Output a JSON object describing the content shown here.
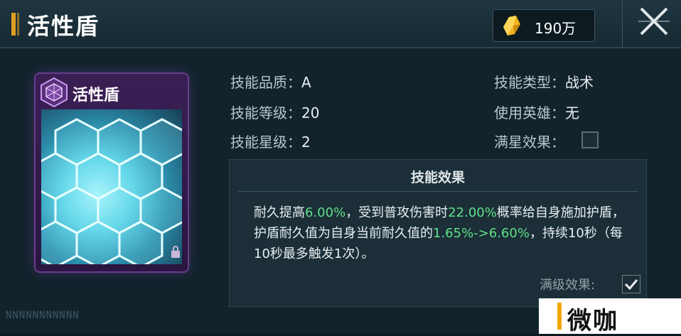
{
  "header": {
    "title": "活性盾",
    "currency_value": "190万",
    "currency_icon": "crystal-icon",
    "close_icon": "close-icon"
  },
  "card": {
    "title": "活性盾",
    "badge_icon": "hexagon-shield-icon",
    "lock_icon": "lock-icon"
  },
  "serial_text": "NNNNNNNNNNN",
  "stats_left": [
    {
      "label": "技能品质：",
      "value": "A"
    },
    {
      "label": "技能等级：",
      "value": "20"
    },
    {
      "label": "技能星级：",
      "value": "2"
    }
  ],
  "stats_right": [
    {
      "label": "技能类型：",
      "value": "战术"
    },
    {
      "label": "使用英雄：",
      "value": "无"
    },
    {
      "label": "满星效果：",
      "checked": false
    }
  ],
  "effect": {
    "title": "技能效果",
    "part1": "耐久提高",
    "hl1": "6.00%",
    "part2": "，受到普攻伤害时",
    "hl2": "22.00%",
    "part3": "概率给自身施加护盾，护盾耐久值为自身当前耐久值的",
    "hl3": "1.65%->6.60%",
    "part4": "，持续10秒（每10秒最多触发1次）。",
    "max_level_label": "满级效果:",
    "max_level_checked": true
  },
  "watermark": "微咖",
  "colors": {
    "accent": "#e0a020",
    "highlight": "#5fe08a",
    "card_border": "#6a3c8c"
  }
}
